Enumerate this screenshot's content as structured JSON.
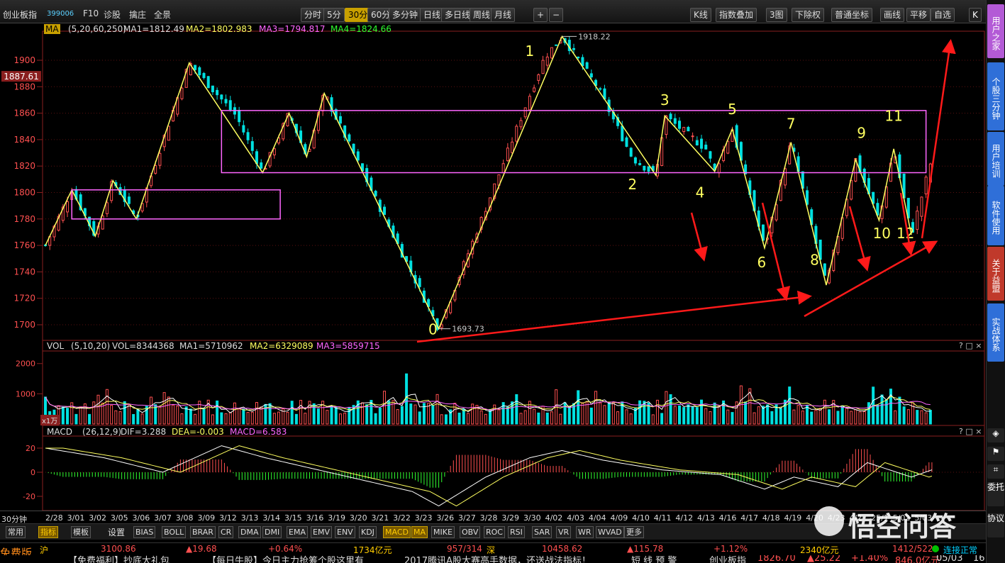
{
  "toolbar": {
    "name": "创业板指",
    "code": "399006",
    "f10": "F10",
    "diagnose": "诊股",
    "zoom": "擒庄",
    "panorama": "全景",
    "periods": [
      "分时",
      "5分",
      "30分",
      "60分",
      "多分钟",
      "日线",
      "多日线",
      "周线",
      "月线"
    ],
    "selected_period": "30分",
    "right_buttons": [
      "K线",
      "指数叠加",
      "3图",
      "下除权",
      "普通坐标",
      "画线",
      "平移",
      "自选"
    ]
  },
  "sidebar": [
    "用户之家",
    "个股三分钟",
    "用户培训",
    "软件使用",
    "关于益盟",
    "实战体系"
  ],
  "sidebar_bottom": [
    "委托",
    "协议"
  ],
  "main": {
    "ma_tag": "MA",
    "ma_params": "(5,20,60,250)",
    "ma1": "MA1=1812.49",
    "ma2": "MA2=1802.983",
    "ma3": "MA3=1794.817",
    "ma4": "MA4=1824.66",
    "price_ticks": [
      "1900",
      "1880",
      "1860",
      "1840",
      "1820",
      "1800",
      "1780",
      "1760",
      "1740",
      "1720",
      "1700"
    ],
    "current_price": "1887.61",
    "high_label": "1918.22",
    "low_label": "1693.73",
    "wave_labels": [
      "0",
      "1",
      "2",
      "3",
      "4",
      "5",
      "6",
      "7",
      "8",
      "9",
      "10",
      "11",
      "12"
    ]
  },
  "vol": {
    "tag": "VOL",
    "params": "(5,10,20)",
    "vol": "VOL=8344368",
    "ma1": "MA1=5710962",
    "ma2": "MA2=6329089",
    "ma3": "MA3=5859715",
    "ticks": [
      "2000",
      "1000"
    ],
    "unit": "x1万"
  },
  "macd": {
    "tag": "MACD",
    "params": "(26,12,9)",
    "dif": "DIF=3.288",
    "dea": "DEA=-0.003",
    "macd": "MACD=6.583",
    "ticks": [
      "20",
      "0",
      "-20"
    ]
  },
  "axis": {
    "period_label": "30分钟",
    "dates": [
      "2/28",
      "3/01",
      "3/02",
      "3/05",
      "3/06",
      "3/07",
      "3/08",
      "3/09",
      "3/12",
      "3/13",
      "3/14",
      "3/15",
      "3/16",
      "3/19",
      "3/20",
      "3/21",
      "3/22",
      "3/23",
      "3/26",
      "3/27",
      "3/28",
      "3/29",
      "3/30",
      "4/02",
      "4/03",
      "4/04",
      "4/09",
      "4/10",
      "4/11",
      "4/12",
      "4/13",
      "4/16",
      "4/17",
      "4/18",
      "4/19",
      "4/20",
      "4/23",
      "4/2",
      "25/1",
      "5/02",
      "5/03"
    ]
  },
  "tabs": {
    "common": "常用",
    "indicator": "指标",
    "template": "模板",
    "settings": "设置",
    "items": [
      "BIAS",
      "BOLL",
      "BRAR",
      "CR",
      "DMA",
      "DMI",
      "EMA",
      "EMV",
      "ENV",
      "KDJ",
      "MACD",
      "MA",
      "MIKE",
      "OBV",
      "ROC",
      "RSI",
      "SAR",
      "VR",
      "WR",
      "WVAD",
      "更多"
    ],
    "selected": [
      "MACD",
      "MA"
    ]
  },
  "status": {
    "sh_label": "沪",
    "sh_index": "3100.86",
    "sh_change": "▲19.68",
    "sh_pct": "+0.64%",
    "sh_amount": "1734亿元",
    "sh_updown": "957/314",
    "sz_label": "深",
    "sz_index": "10458.62",
    "sz_change": "▲115.78",
    "sz_pct": "+1.12%",
    "sz_amount": "2340亿元",
    "sz_updown": "1412/522",
    "connection": "连接正常",
    "free_version": "免费版"
  },
  "news": [
    "【免费福利】抄底大礼包",
    "【每日牛股】今日主力抢筹个股这里有",
    "2017腾讯A股大赛高手数据，还送战法指标！",
    "短 线 预 警",
    "创业板指",
    "1826.70",
    "▲25.22",
    "+1.40%",
    "846.0亿元",
    "05/03",
    "16:5"
  ],
  "watermark": "悟空问答",
  "colors": {
    "up": "#ff5050",
    "down": "#00e0e0",
    "ma_yellow": "#ffff60",
    "box": "#ff66ff",
    "arrow": "#ff1a1a",
    "accent": "#c8a000"
  }
}
